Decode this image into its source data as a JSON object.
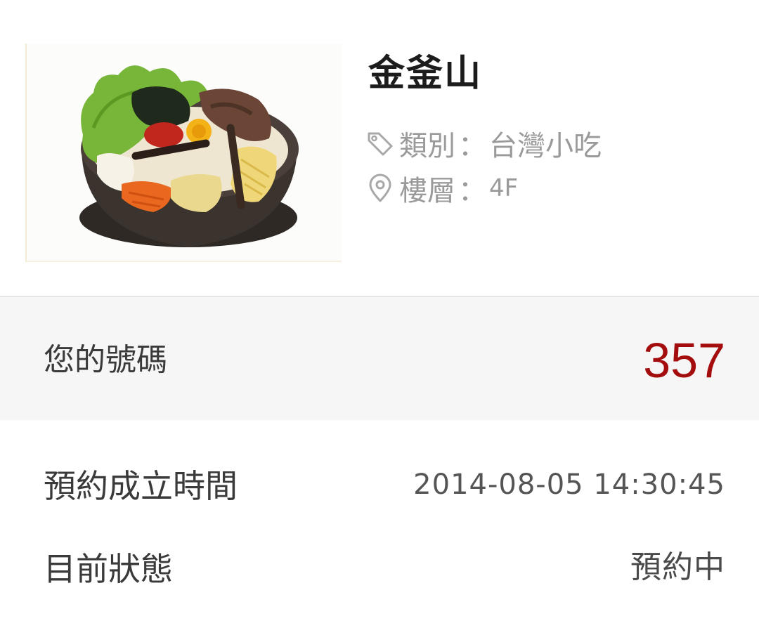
{
  "restaurant": {
    "name": "金釜山",
    "category_label": "類別",
    "category_value": "台灣小吃",
    "floor_label": "樓層",
    "floor_value": "4F",
    "separator": "：",
    "photo_icon": "bibimbap-photo",
    "category_icon": "tag-icon",
    "floor_icon": "location-pin-icon"
  },
  "queue": {
    "number_label": "您的號碼",
    "number_value": "357",
    "number_color": "#a30d0d"
  },
  "details": {
    "reserve_time_label": "預約成立時間",
    "reserve_time_value": "2014-08-05 14:30:45",
    "status_label": "目前狀態",
    "status_value": "預約中"
  }
}
